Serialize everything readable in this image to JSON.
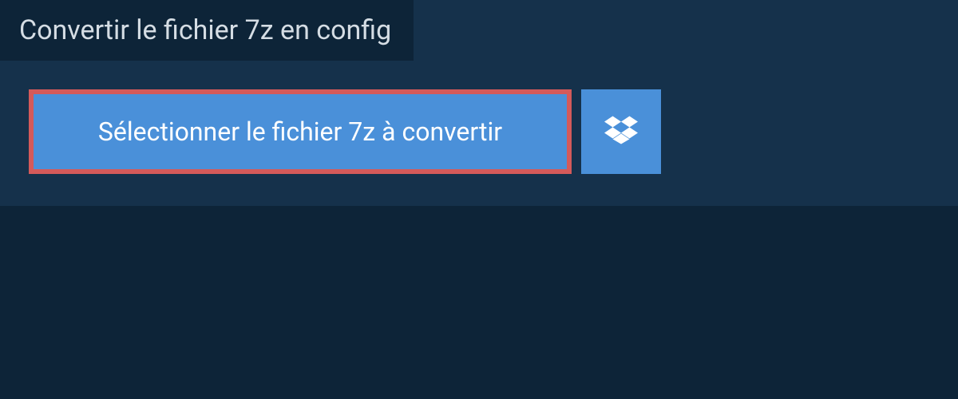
{
  "title": "Convertir le fichier 7z en config",
  "selectButton": {
    "label": "Sélectionner le fichier 7z à convertir"
  },
  "colors": {
    "pageBackground": "#0d2438",
    "panelBackground": "#15314b",
    "buttonBackground": "#4a90d9",
    "highlightBorder": "#d45a5a",
    "textLight": "#ffffff",
    "titleText": "#d5dde4"
  }
}
